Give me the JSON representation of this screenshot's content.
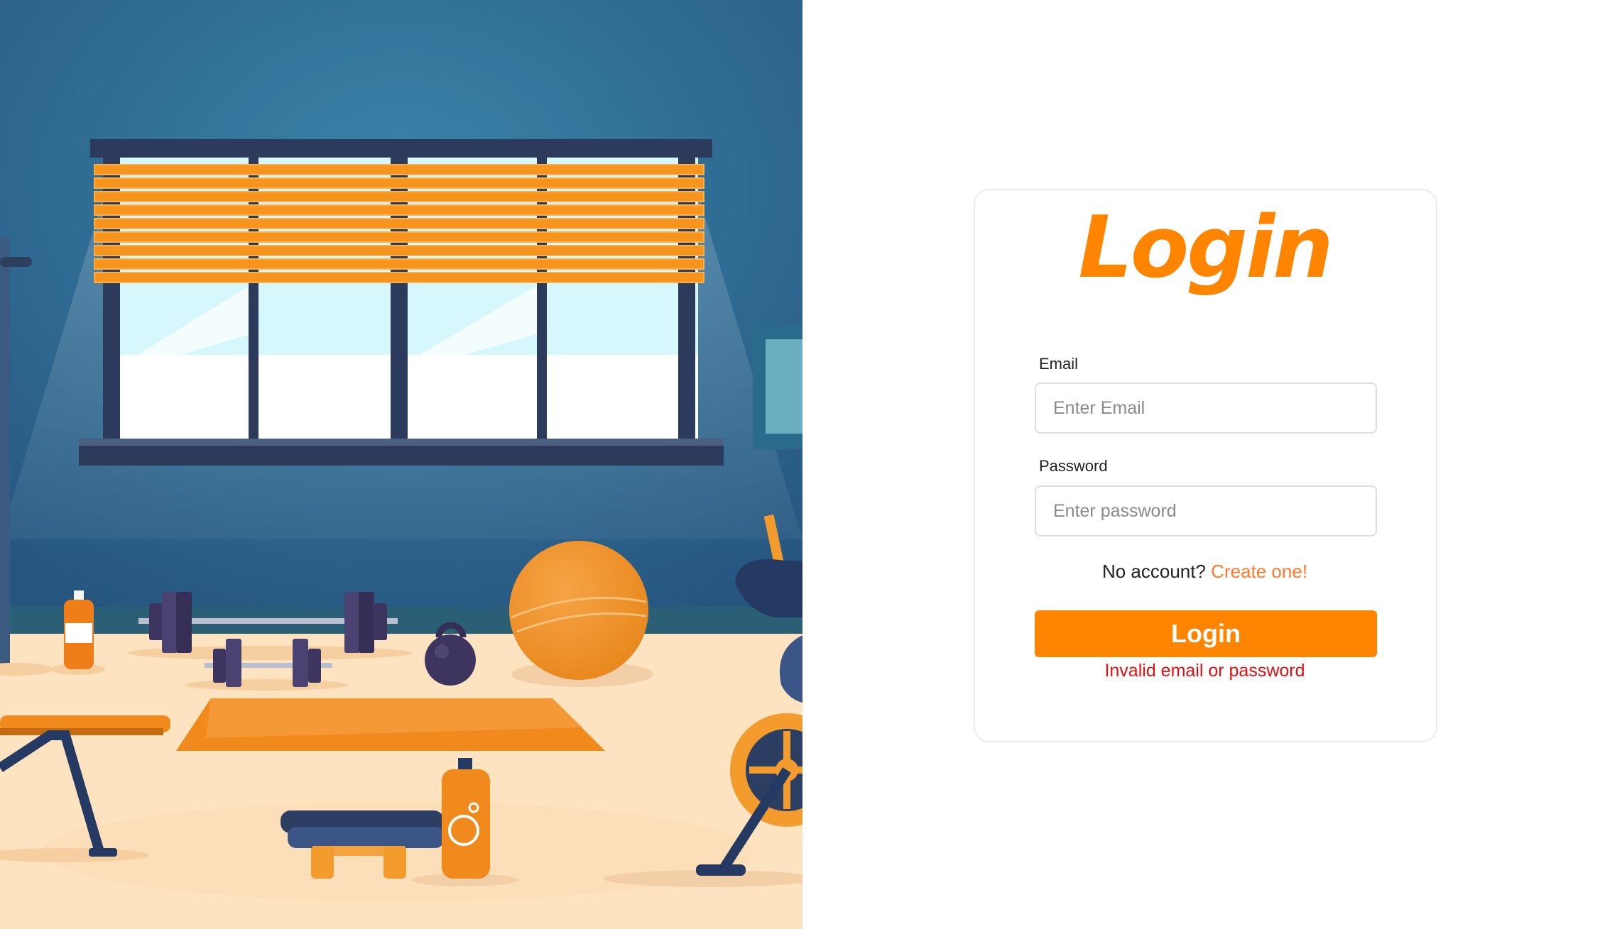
{
  "login": {
    "title": "Login",
    "email_label": "Email",
    "email_placeholder": "Enter Email",
    "email_value": "",
    "password_label": "Password",
    "password_placeholder": "Enter password",
    "password_value": "",
    "signup_prompt": "No account?",
    "signup_link": "Create one!",
    "submit_label": "Login",
    "error_message": "Invalid email or password"
  },
  "colors": {
    "accent": "#ff8500",
    "link": "#ff7a2e",
    "error": "#e01010",
    "wall": "#2f6d93",
    "floor": "#fde3c0"
  },
  "hero": {
    "icons": [
      "window-blinds-icon",
      "barbell-icon",
      "dumbbell-icon",
      "kettlebell-icon",
      "exercise-ball-icon",
      "yoga-mat-icon",
      "water-bottle-icon",
      "towel-icon",
      "exercise-bike-icon",
      "weight-bench-icon"
    ]
  }
}
